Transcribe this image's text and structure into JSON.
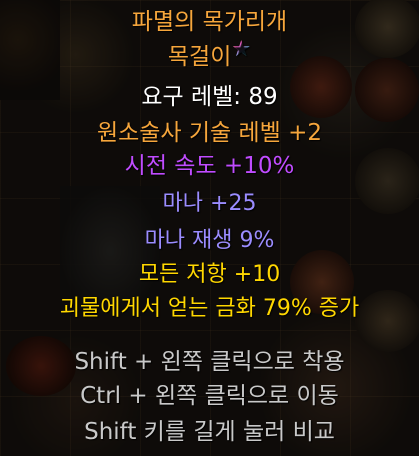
{
  "item": {
    "name": "파멸의 목가리개",
    "type": "목걸이",
    "rarity_icon": "rainbow-star-icon",
    "requirement": "요구 레벨: 89",
    "modifiers": [
      "원소술사 기술 레벨 +2",
      "시전 속도 +10%",
      "마나 +25",
      "마나 재생 9%",
      "모든 저항 +10",
      "괴물에게서 얻는 금화 79% 증가"
    ]
  },
  "hints": [
    "Shift + 왼쪽 클릭으로 착용",
    "Ctrl + 왼쪽 클릭으로 이동",
    "Shift 키를 길게 눌러 비교"
  ],
  "colors": {
    "unique_orange": "#f6a63c",
    "white": "#ffffff",
    "purple": "#c04cff",
    "blue": "#9b8cff",
    "gold": "#ffd700",
    "hint_gray": "#c9c9c9"
  }
}
